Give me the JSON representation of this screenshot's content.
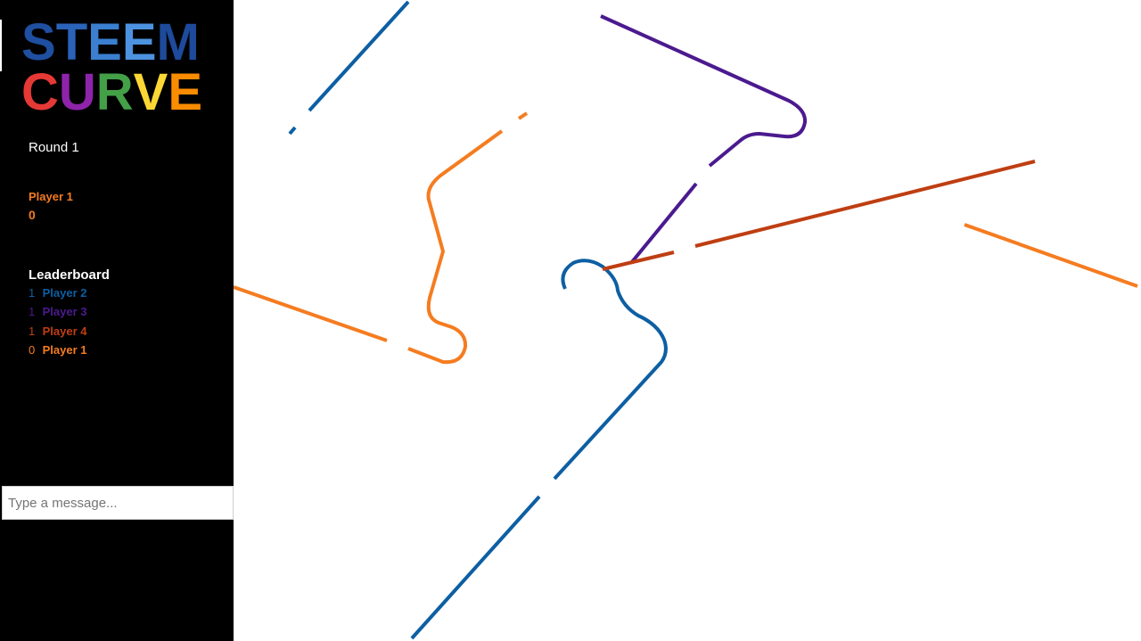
{
  "logo": {
    "line1": [
      {
        "char": "S",
        "color": "#1f4fa0"
      },
      {
        "char": "T",
        "color": "#2a63b8"
      },
      {
        "char": "E",
        "color": "#3a7fd0"
      },
      {
        "char": "E",
        "color": "#4c92e0"
      },
      {
        "char": "M",
        "color": "#1d4a9b"
      }
    ],
    "line2": [
      {
        "char": "C",
        "color": "#e53935"
      },
      {
        "char": "U",
        "color": "#8e24aa"
      },
      {
        "char": "R",
        "color": "#43a047"
      },
      {
        "char": "V",
        "color": "#fdd835"
      },
      {
        "char": "E",
        "color": "#fb8c00"
      }
    ]
  },
  "round": {
    "label": "Round 1"
  },
  "current_player": {
    "name": "Player 1",
    "score": "0",
    "color": "#f57c20"
  },
  "leaderboard": {
    "title": "Leaderboard",
    "entries": [
      {
        "score": "1",
        "name": "Player 2",
        "color": "#0d5fa3"
      },
      {
        "score": "1",
        "name": "Player 3",
        "color": "#4b1a8f"
      },
      {
        "score": "1",
        "name": "Player 4",
        "color": "#bf3e12"
      },
      {
        "score": "0",
        "name": "Player 1",
        "color": "#f57c20"
      }
    ]
  },
  "chat": {
    "placeholder": "Type a message..."
  },
  "colors": {
    "sidebar_bg": "#000000",
    "arena_bg": "#ffffff",
    "player1": "#f57c20",
    "player2": "#0d5fa3",
    "player3": "#4b1a8f",
    "player4": "#bf3e12"
  }
}
